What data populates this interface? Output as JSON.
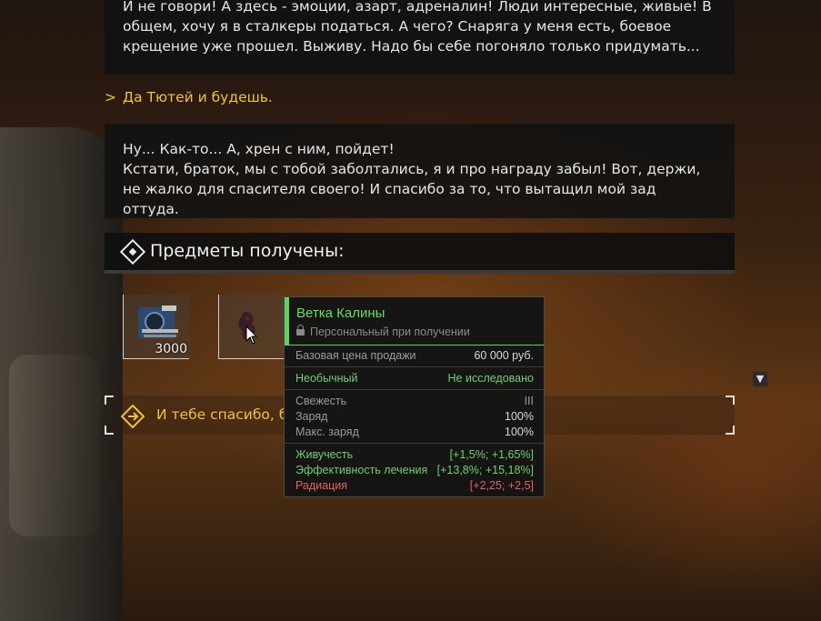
{
  "dialog": {
    "npc_text_1": "И не говори! А здесь - эмоции, азарт, адреналин! Люди интересные, живые! В общем, хочу я в сталкеры податься. А чего? Снаряга у меня есть, боевое крещение уже прошел. Выживу. Надо бы себе погоняло только придумать...",
    "player_answer_marker": ">",
    "player_answer": "Да Тютей и будешь.",
    "npc_text_2_line1": "Ну... Как-то... А, хрен с ним, пойдет!",
    "npc_text_2_line2": "Кстати, браток, мы с тобой заболтались, я и про награду забыл! Вот, держи, не жалко для спасителя своего! И спасибо за то, что вытащил мой зад оттуда."
  },
  "items_header": {
    "title": "Предметы получены:"
  },
  "items": [
    {
      "icon": "ammo-box-icon",
      "count": "3000"
    },
    {
      "icon": "artifact-icon"
    }
  ],
  "choice": {
    "text": "И тебе спасибо, б"
  },
  "tooltip": {
    "name": "Ветка Калины",
    "personal": "Персональный при получении",
    "base_price_label": "Базовая цена продажи",
    "base_price_value": "60 000 руб.",
    "rarity": "Необычный",
    "research": "Не исследовано",
    "freshness_label": "Свежесть",
    "freshness_value": "III",
    "charge_label": "Заряд",
    "charge_value": "100%",
    "max_charge_label": "Макс. заряд",
    "max_charge_value": "100%",
    "stats": [
      {
        "label": "Живучесть",
        "value": "[+1,5%; +1,65%]",
        "color": "#6fd16f"
      },
      {
        "label": "Эффективность лечения",
        "value": "[+13,8%; +15,18%]",
        "color": "#6fd16f"
      },
      {
        "label": "Радиация",
        "value": "[+2,25; +2,5]",
        "color": "#e06464"
      }
    ]
  },
  "colors": {
    "accent_yellow": "#f0c23a",
    "rarity_green": "#5fd35f",
    "negative_red": "#e06464"
  }
}
